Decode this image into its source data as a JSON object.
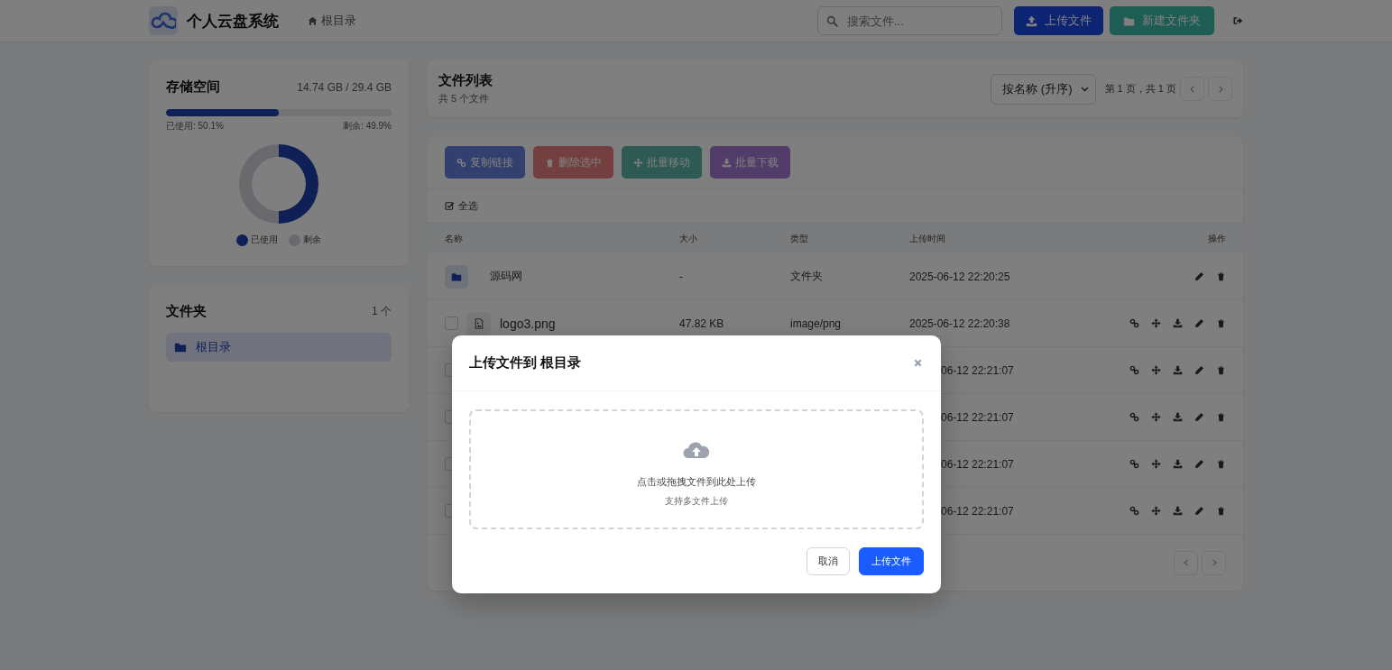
{
  "header": {
    "title": "个人云盘系统",
    "breadcrumb": "根目录",
    "search": {
      "placeholder": "搜索文件..."
    },
    "buttons": [
      {
        "label": "上传文件",
        "kind": "upload"
      },
      {
        "label": "新建文件夹",
        "kind": "folder"
      }
    ]
  },
  "storage": {
    "title": "存储空间",
    "usage": "14.74 GB / 29.4 GB",
    "level": 0.501,
    "used_label": "已使用: 50.1%",
    "free_label": "剩余: 49.9%",
    "chart_data": {
      "type": "donut",
      "categories": [
        "已使用",
        "剩余"
      ],
      "values": [
        50.1,
        49.9
      ],
      "colors": [
        "#1e40af",
        "#d1d5db"
      ]
    }
  },
  "folders": {
    "title": "文件夹",
    "count": "1 个",
    "items": [
      {
        "label": "根目录",
        "selected": true
      }
    ]
  },
  "file_list": {
    "title": "文件列表",
    "subtitle": "共 5 个文件",
    "sort": "按名称 (升序)",
    "page_info": "第 1 页，共 1 页"
  },
  "bulk_actions": [
    {
      "label": "复制链接",
      "kind": "link",
      "disabled": true
    },
    {
      "label": "删除选中",
      "kind": "delete",
      "disabled": true
    },
    {
      "label": "批量移动",
      "kind": "move",
      "disabled": true
    },
    {
      "label": "批量下载",
      "kind": "download",
      "disabled": true
    }
  ],
  "select_all": {
    "label": "全选",
    "checked": true
  },
  "table": {
    "columns": [
      "名称",
      "大小",
      "类型",
      "上传时间",
      "操作"
    ],
    "rows": [
      {
        "kind": "folder",
        "name": "源码网",
        "size": "-",
        "type": "文件夹",
        "time": "2025-06-12 22:20:25"
      },
      {
        "kind": "file",
        "checked": false,
        "name": "logo3.png",
        "size": "47.82 KB",
        "type": "image/png",
        "time": "2025-06-12 22:20:38"
      },
      {
        "kind": "covered",
        "time": "06-12 22:21:07"
      },
      {
        "kind": "covered",
        "time": "06-12 22:21:07"
      },
      {
        "kind": "covered",
        "time": "06-12 22:21:07"
      },
      {
        "kind": "covered",
        "time": "06-12 22:21:07"
      }
    ]
  },
  "modal": {
    "title": "上传文件到 根目录",
    "drop_text": "点击或拖拽文件到此处上传",
    "drop_hint": "支持多文件上传",
    "buttons": [
      {
        "label": "取消",
        "kind": "secondary"
      },
      {
        "label": "上传文件",
        "kind": "primary"
      }
    ]
  }
}
